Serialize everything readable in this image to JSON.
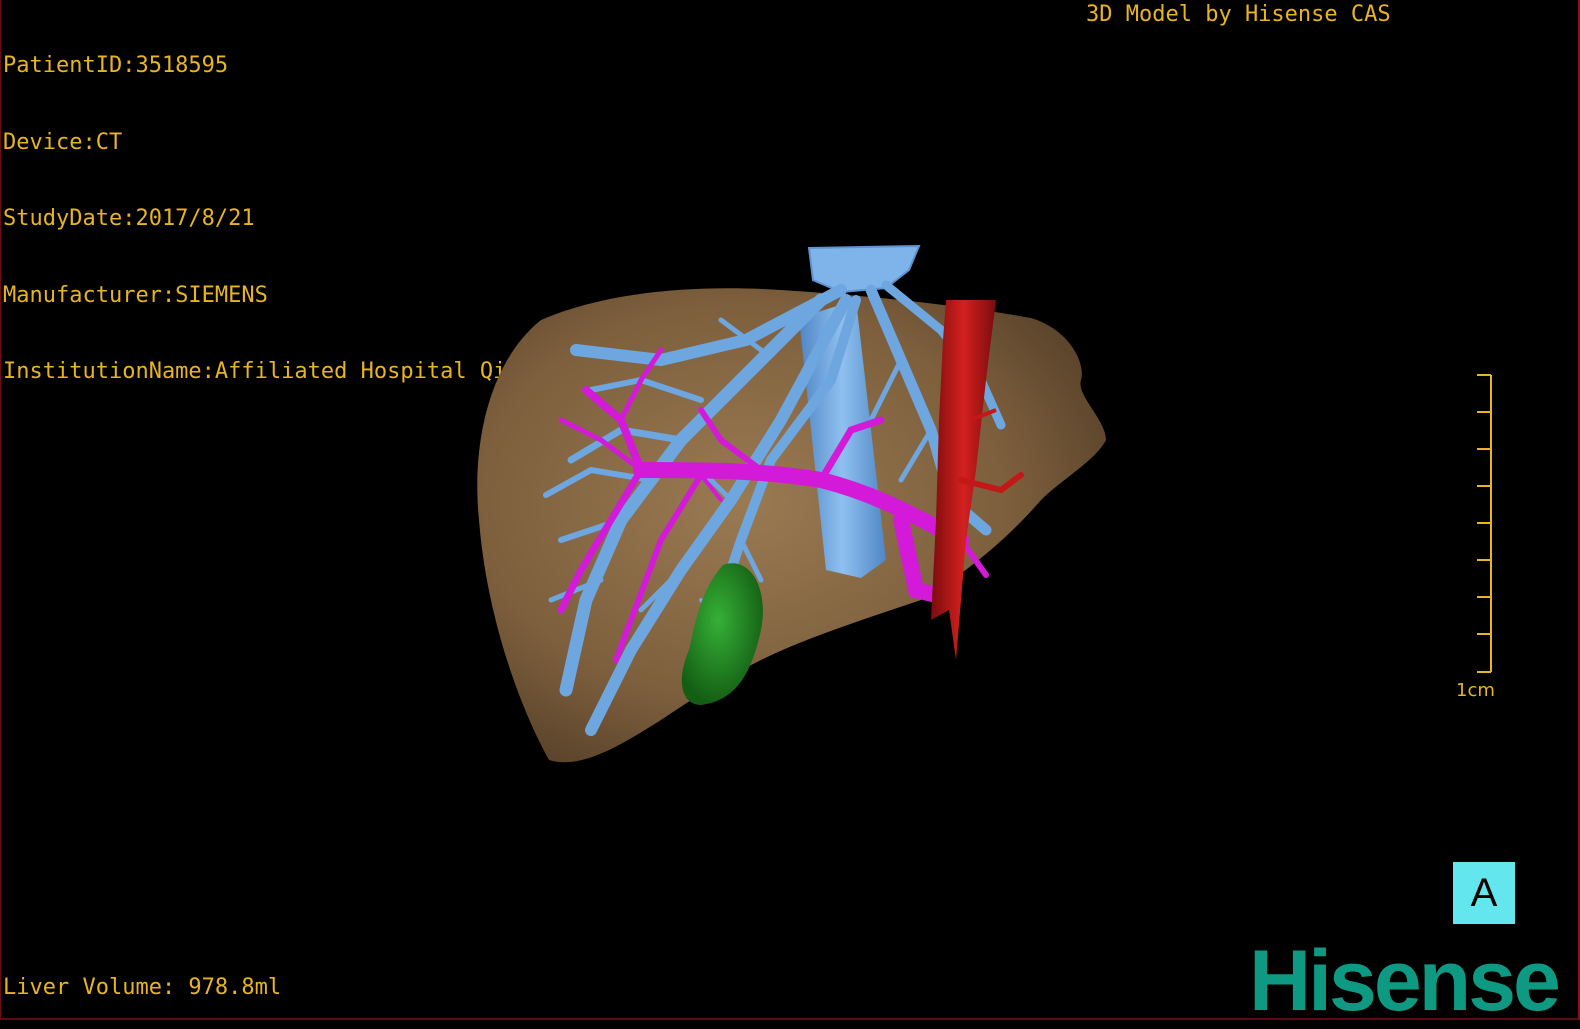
{
  "patient": {
    "patient_id": "PatientID:3518595",
    "device": "Device:CT",
    "study_date": "StudyDate:2017/8/21",
    "manufacturer": "Manufacturer:SIEMENS",
    "institution": "InstitutionName:Affiliated Hospital Qingdao University-C"
  },
  "model_credit": "3D Model by Hisense CAS",
  "liver_volume": "Liver Volume: 978.8ml",
  "scale": {
    "label": "1cm"
  },
  "orientation": {
    "label": "A"
  },
  "brand": {
    "logo_text": "Hisense"
  },
  "colors": {
    "text": "#e8b422",
    "liver": "#8b6a45",
    "hepatic_vein": "#6ea6e0",
    "portal_vein": "#d21ad8",
    "artery": "#b51414",
    "gallbladder": "#1f8a1f",
    "orientation_box": "#63e6ee",
    "logo": "#0e9a82"
  },
  "structures": [
    "liver",
    "hepatic-vein",
    "portal-vein",
    "artery",
    "gallbladder"
  ]
}
